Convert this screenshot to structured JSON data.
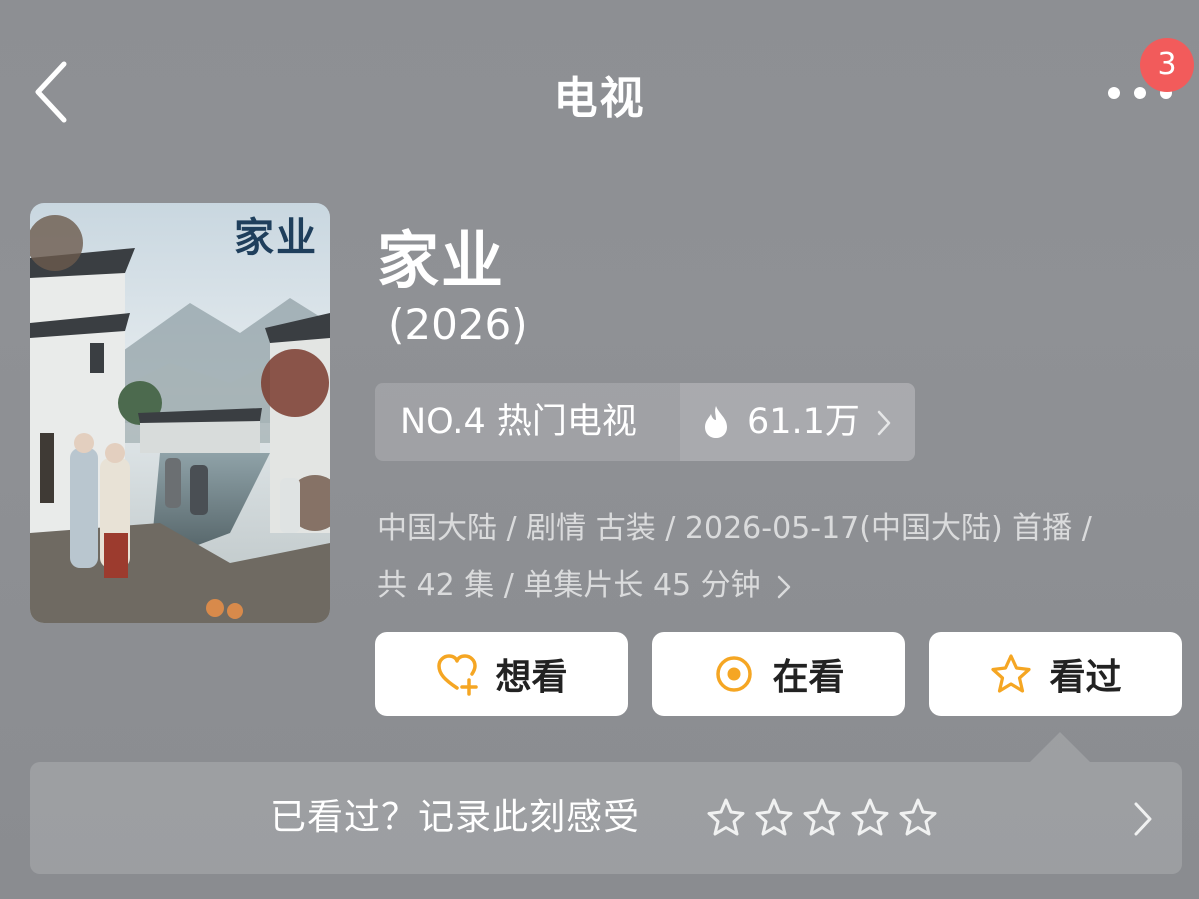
{
  "header": {
    "title": "电视",
    "back_icon": "chevron-left-icon",
    "more_icon": "more-horizontal-icon",
    "notification_count": "3"
  },
  "poster": {
    "title_text": "家业"
  },
  "show": {
    "name": "家业",
    "year": "(2026)"
  },
  "ranking": {
    "label": "NO.4 热门电视",
    "heat_value": "61.1万",
    "heat_icon": "flame-icon"
  },
  "meta": {
    "line1": "中国大陆 / 剧情 古装 / 2026-05-17(中国大陆) 首播 /",
    "line2": "共 42 集 / 单集片长 45 分钟"
  },
  "actions": {
    "want": {
      "label": "想看",
      "icon": "heart-plus-icon"
    },
    "watching": {
      "label": "在看",
      "icon": "target-circle-icon"
    },
    "watched": {
      "label": "看过",
      "icon": "star-outline-icon"
    }
  },
  "rating": {
    "prompt": "已看过？记录此刻感受",
    "stars": 5,
    "star_icon": "star-outline-icon"
  },
  "colors": {
    "accent": "#f5a623",
    "badge": "#f25b5b",
    "background": "#8e9094"
  }
}
